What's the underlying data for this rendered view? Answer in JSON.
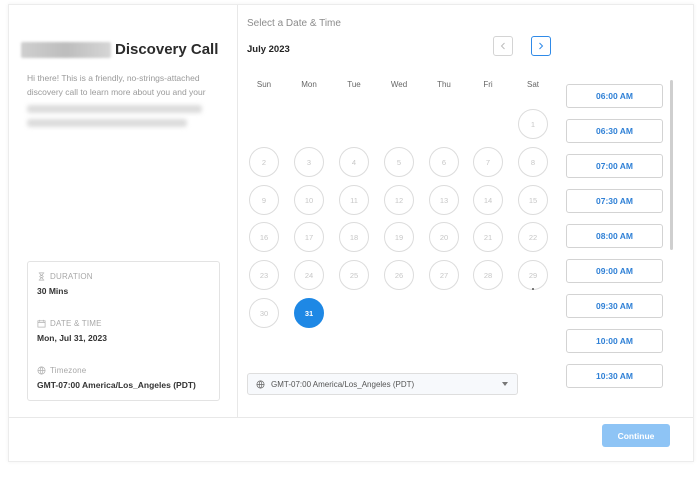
{
  "event": {
    "title": "Discovery Call",
    "description": "Hi there! This is a friendly, no-strings-attached discovery call to learn more about you and your"
  },
  "details": {
    "duration_label": "DURATION",
    "duration_value": "30 Mins",
    "datetime_label": "DATE & TIME",
    "datetime_value": "Mon, Jul 31, 2023",
    "timezone_label": "Timezone",
    "timezone_value": "GMT-07:00 America/Los_Angeles (PDT)"
  },
  "calendar": {
    "section_title": "Select a Date & Time",
    "month": "July 2023",
    "weekdays": [
      "Sun",
      "Mon",
      "Tue",
      "Wed",
      "Thu",
      "Fri",
      "Sat"
    ],
    "first_weekday_index": 6,
    "days_in_month": 31,
    "selected_day": 31
  },
  "timezone_select": {
    "value": "GMT-07:00 America/Los_Angeles (PDT)"
  },
  "time_slots": [
    "06:00 AM",
    "06:30 AM",
    "07:00 AM",
    "07:30 AM",
    "08:00 AM",
    "09:00 AM",
    "09:30 AM",
    "10:00 AM",
    "10:30 AM"
  ],
  "footer": {
    "continue_label": "Continue"
  },
  "colors": {
    "accent": "#1e88e5",
    "slot_text": "#2f80d6",
    "continue_bg": "#8ec4f5"
  },
  "icons": {
    "prev": "chevron-left-icon",
    "next": "chevron-right-icon",
    "duration": "hourglass-icon",
    "date": "calendar-icon",
    "timezone": "globe-icon",
    "dropdown": "caret-down-icon"
  }
}
